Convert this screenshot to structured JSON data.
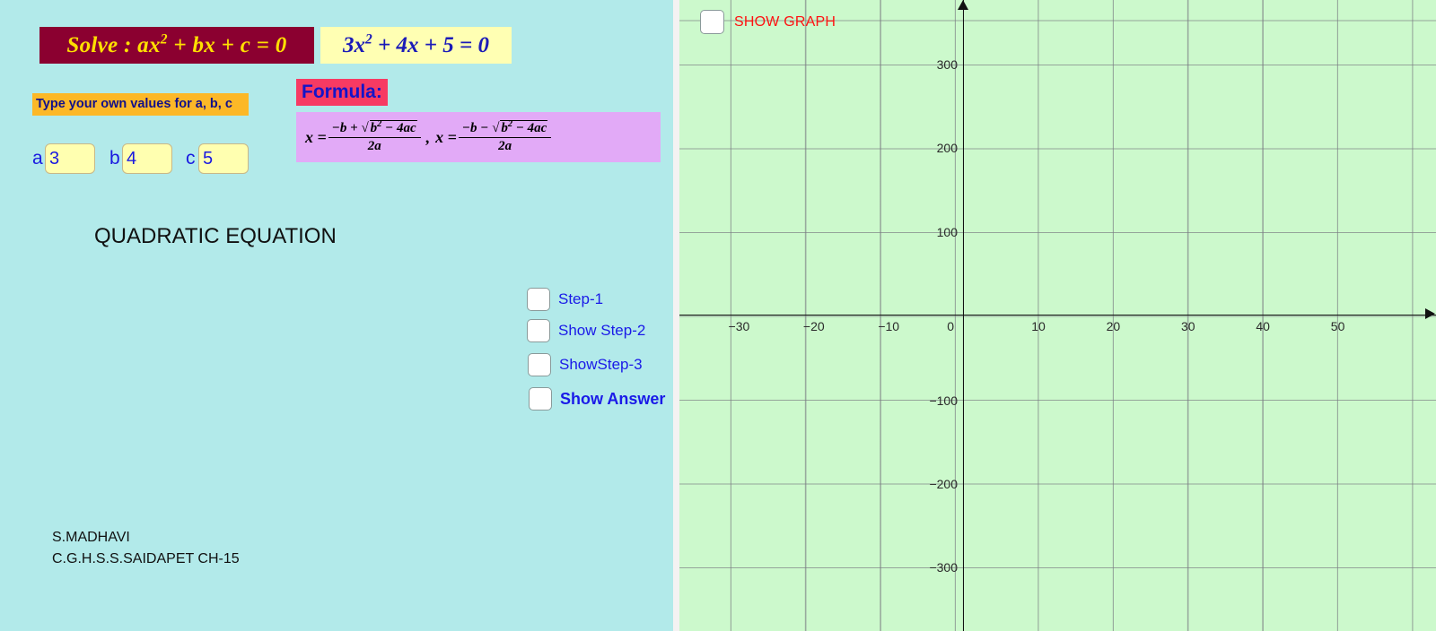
{
  "left": {
    "solve_title": "Solve : ax² + bx + c = 0",
    "solve_title_prefix": "Solve : ax",
    "solve_title_suffix": " + bx + c = 0",
    "equation_prefix": "3x",
    "equation_suffix": " + 4x + 5 = 0",
    "values_banner": "Type your own values for a, b, c",
    "coefficients": [
      {
        "label": "a",
        "value": "3"
      },
      {
        "label": "b",
        "value": "4"
      },
      {
        "label": "c",
        "value": "5"
      }
    ],
    "formula_label": "Formula:",
    "formula": {
      "lhs1": "x =",
      "num1_lead": "−b +",
      "radicand": "b",
      "radicand_exp": "2",
      "radicand_rest": " − 4ac",
      "den": "2a",
      "separator": ",",
      "lhs2": "x =",
      "num2_lead": "−b −"
    },
    "heading": "QUADRATIC EQUATION",
    "steps": [
      {
        "label": "Step-1",
        "checked": false
      },
      {
        "label": "Show Step-2",
        "checked": false
      },
      {
        "label": "ShowStep-3",
        "checked": false
      },
      {
        "label": "Show Answer",
        "checked": false
      }
    ],
    "credit_name": "S.MADHAVI",
    "credit_school": "C.G.H.S.S.SAIDAPET CH-15"
  },
  "graph": {
    "show_graph_label": "SHOW GRAPH",
    "show_graph_checked": false,
    "x_ticks": [
      {
        "label": "−30",
        "value": -30
      },
      {
        "label": "−20",
        "value": -20
      },
      {
        "label": "−10",
        "value": -10
      },
      {
        "label": "0",
        "value": 0
      },
      {
        "label": "10",
        "value": 10
      },
      {
        "label": "20",
        "value": 20
      },
      {
        "label": "30",
        "value": 30
      },
      {
        "label": "40",
        "value": 40
      },
      {
        "label": "50",
        "value": 50
      }
    ],
    "y_ticks": [
      {
        "label": "300",
        "value": 300
      },
      {
        "label": "200",
        "value": 200
      },
      {
        "label": "100",
        "value": 100
      },
      {
        "label": "−100",
        "value": -100
      },
      {
        "label": "−200",
        "value": -200
      },
      {
        "label": "−300",
        "value": -300
      }
    ]
  },
  "colors": {
    "panel_bg": "#b2eaea",
    "title_bg": "#8b0030",
    "title_fg": "#ffe000",
    "equation_bg": "#ffffb3",
    "equation_fg": "#1a1ab8",
    "banner_bg": "#fcb827",
    "formula_label_bg": "#f73a63",
    "formula_bg": "#e2aaf7",
    "graph_bg": "#ccf9cc",
    "show_graph_fg": "#ff1111",
    "link_blue": "#1a1ae8"
  },
  "chart_data": {
    "type": "scatter",
    "title": "",
    "xlabel": "",
    "ylabel": "",
    "xlim": [
      -37,
      62
    ],
    "ylim": [
      -375,
      376
    ],
    "x_ticks": [
      -30,
      -20,
      -10,
      0,
      10,
      20,
      30,
      40,
      50
    ],
    "y_ticks": [
      300,
      200,
      100,
      -100,
      -200,
      -300
    ],
    "grid": true,
    "legend": null,
    "series": []
  }
}
